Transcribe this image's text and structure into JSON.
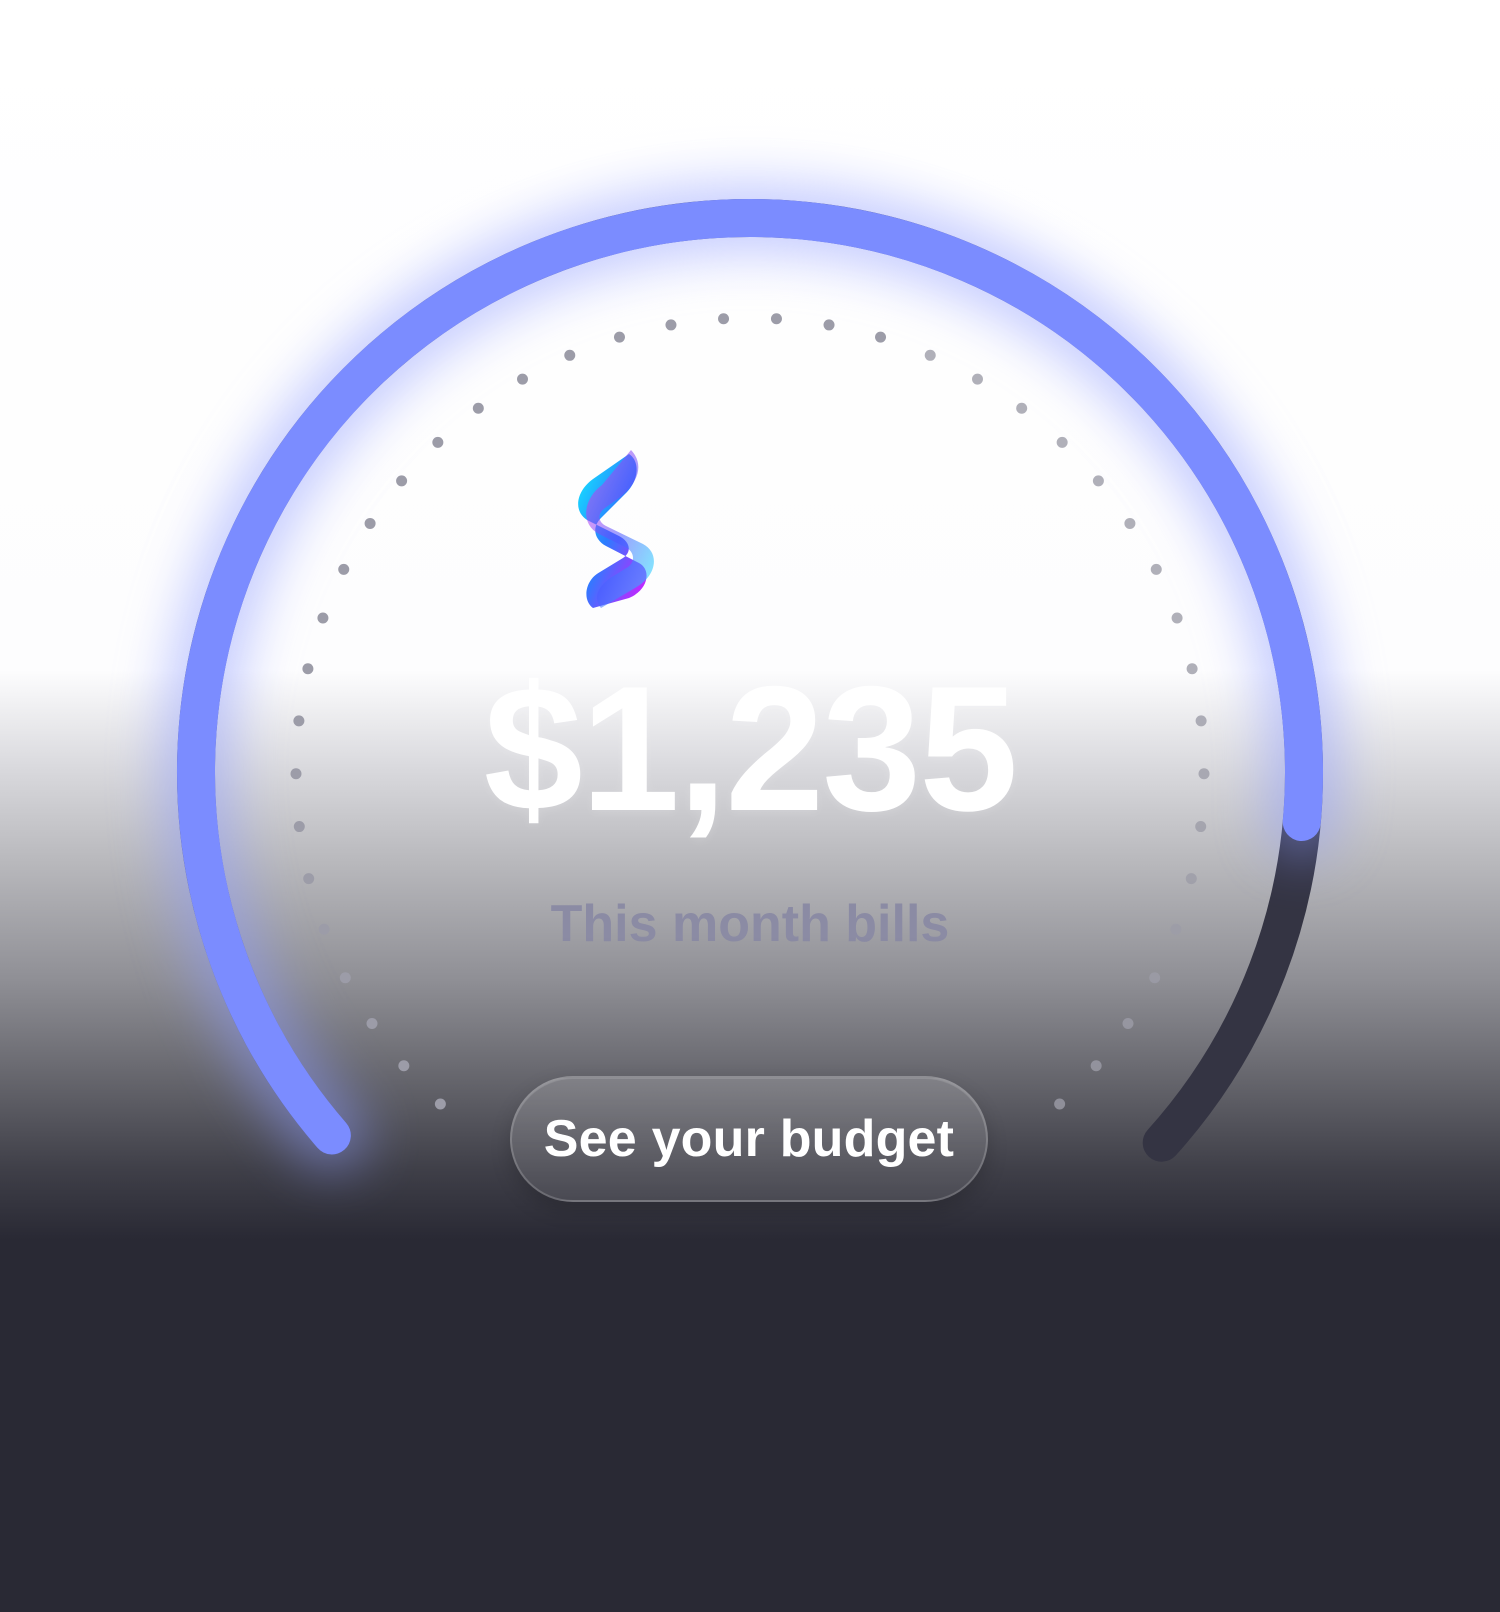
{
  "brand": {
    "logo_icon": "brand-s-logo-icon"
  },
  "bill": {
    "amount": "$1,235",
    "label": "This month bills",
    "budget_progress": 0.86
  },
  "actions": {
    "budget_button_label": "See your budget"
  },
  "colors": {
    "arc_fill": "#7b8cff",
    "arc_track": "#343443",
    "tick_dot": "#9c9ca8",
    "background_dark": "#292934",
    "subtitle": "#8a8aa4"
  }
}
